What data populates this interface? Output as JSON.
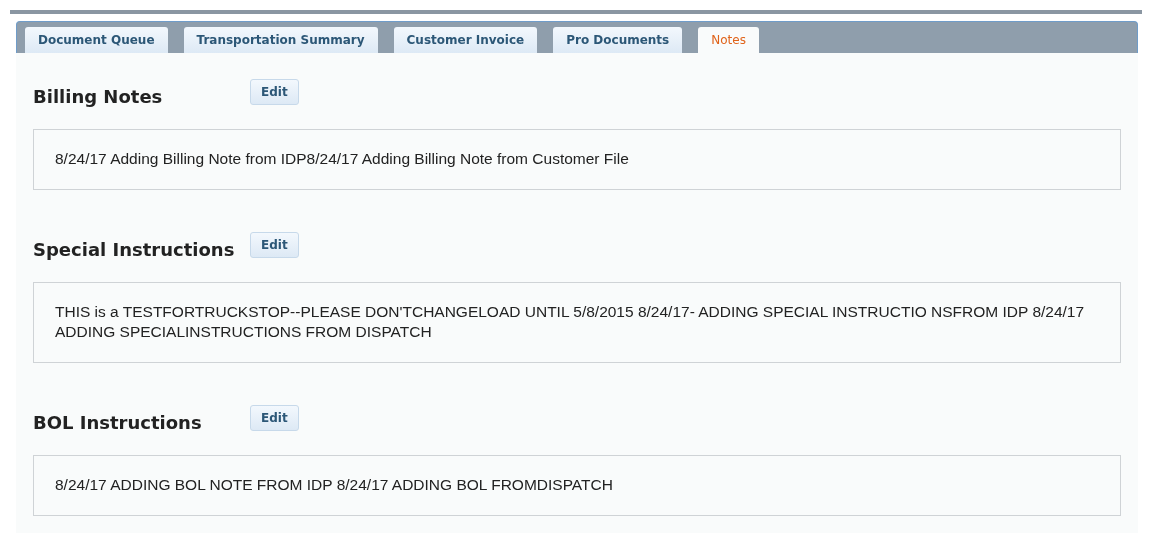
{
  "tabs": [
    {
      "label": "Document Queue",
      "selected": false
    },
    {
      "label": "Transportation Summary",
      "selected": false
    },
    {
      "label": "Customer Invoice",
      "selected": false
    },
    {
      "label": "Pro Documents",
      "selected": false
    },
    {
      "label": "Notes",
      "selected": true
    }
  ],
  "sections": [
    {
      "title": "Billing Notes",
      "button": "Edit",
      "text": "8/24/17 Adding Billing Note from IDP8/24/17 Adding Billing Note from Customer File"
    },
    {
      "title": "Special Instructions",
      "button": "Edit",
      "text": "THIS is a TESTFORTRUCKSTOP--PLEASE DON'TCHANGELOAD UNTIL 5/8/2015 8/24/17- ADDING SPECIAL INSTRUCTIO NSFROM IDP 8/24/17 ADDING SPECIALINSTRUCTIONS FROM DISPATCH"
    },
    {
      "title": "BOL Instructions",
      "button": "Edit",
      "text": "8/24/17 ADDING BOL NOTE FROM IDP 8/24/17 ADDING BOL FROMDISPATCH"
    }
  ]
}
